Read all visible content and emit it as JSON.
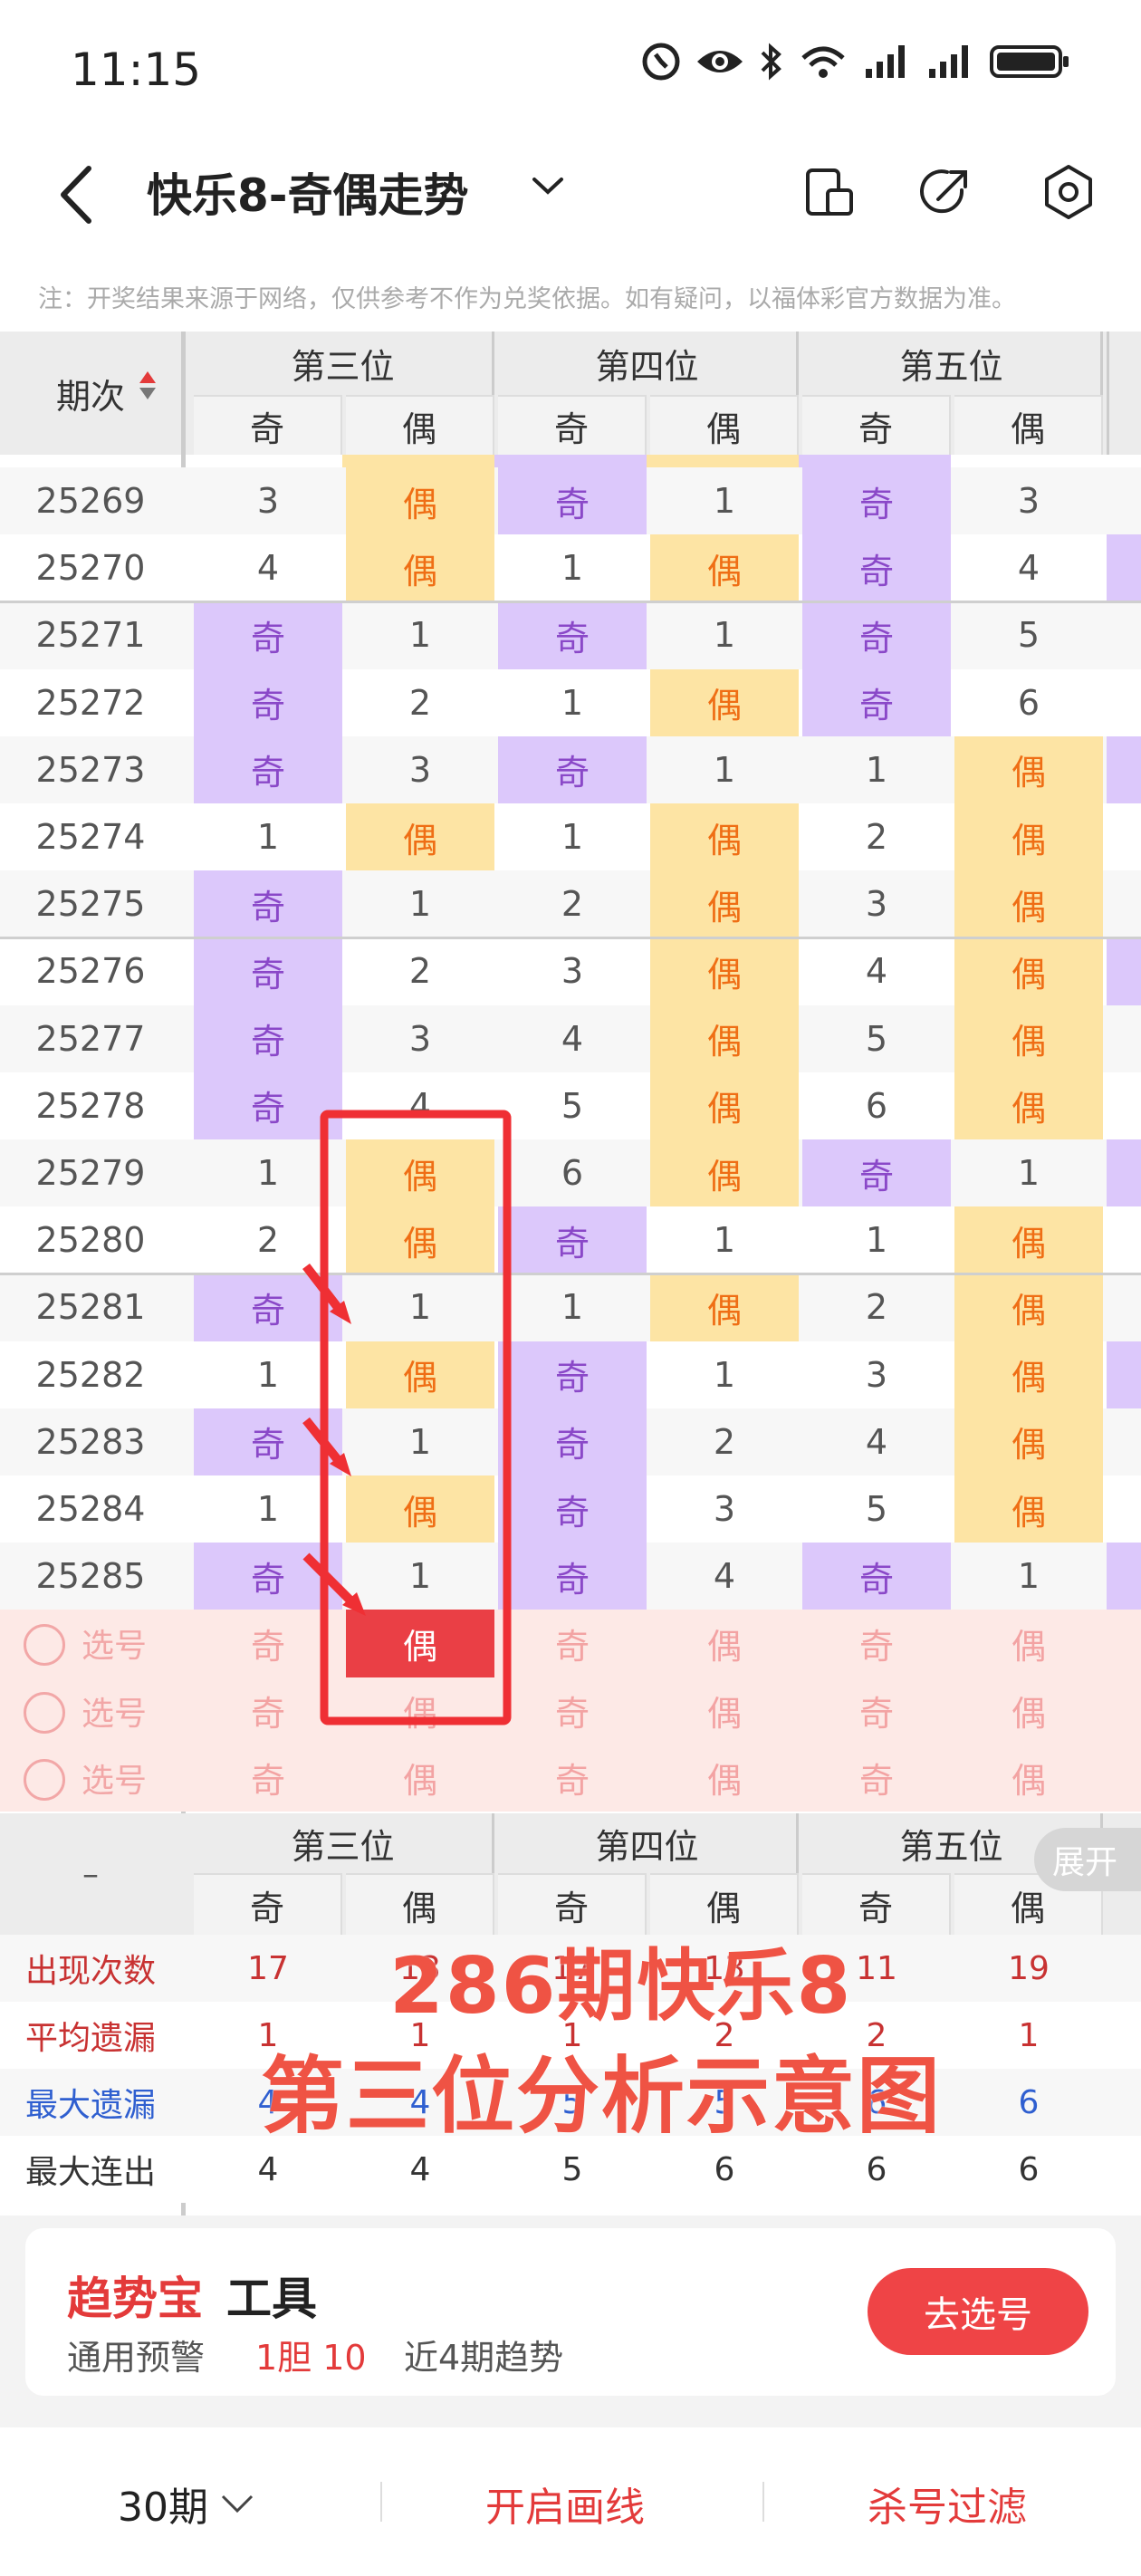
{
  "status_bar": {
    "time": "11:15"
  },
  "header": {
    "title": "快乐8-奇偶走势"
  },
  "notice": "注：开奖结果来源于网络，仅供参考不作为兑奖依据。如有疑问，以福体彩官方数据为准。",
  "table": {
    "period_header": "期次",
    "positions": [
      "第三位",
      "第四位",
      "第五位"
    ],
    "subheads": [
      "奇",
      "偶",
      "奇",
      "偶",
      "奇",
      "偶"
    ],
    "odd_label": "奇",
    "even_label": "偶",
    "rows": [
      {
        "period": "25269",
        "cells": [
          "3",
          "偶",
          "奇",
          "1",
          "奇",
          "3"
        ]
      },
      {
        "period": "25270",
        "cells": [
          "4",
          "偶",
          "1",
          "偶",
          "奇",
          "4"
        ]
      },
      {
        "period": "25271",
        "cells": [
          "奇",
          "1",
          "奇",
          "1",
          "奇",
          "5"
        ]
      },
      {
        "period": "25272",
        "cells": [
          "奇",
          "2",
          "1",
          "偶",
          "奇",
          "6"
        ]
      },
      {
        "period": "25273",
        "cells": [
          "奇",
          "3",
          "奇",
          "1",
          "1",
          "偶"
        ]
      },
      {
        "period": "25274",
        "cells": [
          "1",
          "偶",
          "1",
          "偶",
          "2",
          "偶"
        ]
      },
      {
        "period": "25275",
        "cells": [
          "奇",
          "1",
          "2",
          "偶",
          "3",
          "偶"
        ]
      },
      {
        "period": "25276",
        "cells": [
          "奇",
          "2",
          "3",
          "偶",
          "4",
          "偶"
        ]
      },
      {
        "period": "25277",
        "cells": [
          "奇",
          "3",
          "4",
          "偶",
          "5",
          "偶"
        ]
      },
      {
        "period": "25278",
        "cells": [
          "奇",
          "4",
          "5",
          "偶",
          "6",
          "偶"
        ]
      },
      {
        "period": "25279",
        "cells": [
          "1",
          "偶",
          "6",
          "偶",
          "奇",
          "1"
        ]
      },
      {
        "period": "25280",
        "cells": [
          "2",
          "偶",
          "奇",
          "1",
          "1",
          "偶"
        ]
      },
      {
        "period": "25281",
        "cells": [
          "奇",
          "1",
          "1",
          "偶",
          "2",
          "偶"
        ]
      },
      {
        "period": "25282",
        "cells": [
          "1",
          "偶",
          "奇",
          "1",
          "3",
          "偶"
        ]
      },
      {
        "period": "25283",
        "cells": [
          "奇",
          "1",
          "奇",
          "2",
          "4",
          "偶"
        ]
      },
      {
        "period": "25284",
        "cells": [
          "1",
          "偶",
          "奇",
          "3",
          "5",
          "偶"
        ]
      },
      {
        "period": "25285",
        "cells": [
          "奇",
          "1",
          "奇",
          "4",
          "奇",
          "1"
        ]
      }
    ],
    "select_label": "选号",
    "dash": "–",
    "expand": "展开",
    "stats": [
      {
        "label": "出现次数",
        "color": "#c83232",
        "values": [
          "17",
          "13",
          "17",
          "13",
          "11",
          "19"
        ]
      },
      {
        "label": "平均遗漏",
        "color": "#c83232",
        "values": [
          "1",
          "1",
          "1",
          "2",
          "2",
          "1"
        ]
      },
      {
        "label": "最大遗漏",
        "color": "#2f5fd0",
        "values": [
          "4",
          "4",
          "5",
          "5",
          "6",
          "6"
        ]
      },
      {
        "label": "最大连出",
        "color": "#333333",
        "values": [
          "4",
          "4",
          "5",
          "6",
          "6",
          "6"
        ]
      }
    ]
  },
  "overlay": {
    "line1": "286期快乐8",
    "line2": "第三位分析示意图"
  },
  "tool": {
    "brand": "趋势宝",
    "brand_suffix": "工具",
    "line_prefix": "通用预警",
    "line_hl": "1胆 10",
    "line_suffix": "近4期趋势",
    "button": "去选号"
  },
  "footer": {
    "periods": "30期",
    "draw": "开启画线",
    "filter": "杀号过滤"
  }
}
